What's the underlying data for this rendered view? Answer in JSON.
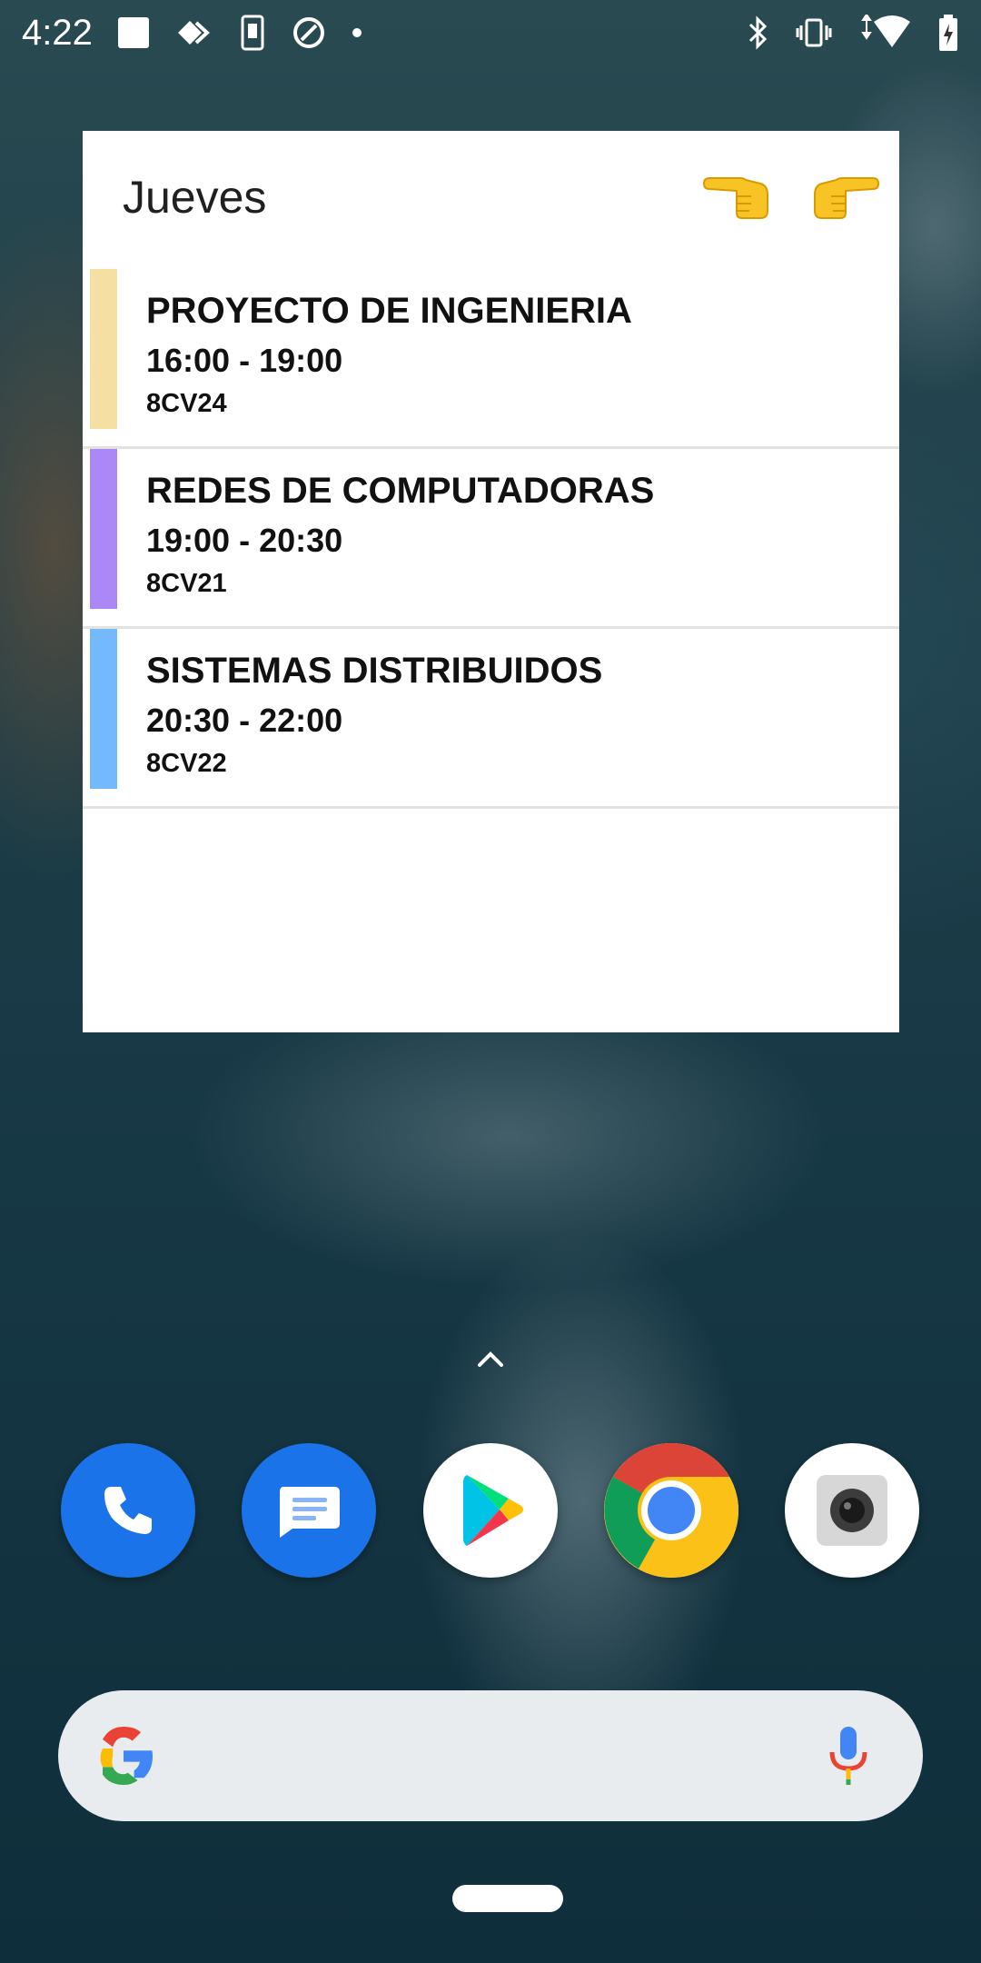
{
  "status_bar": {
    "time": "4:22"
  },
  "widget": {
    "day": "Jueves",
    "nav": {
      "prev_icon": "hand-pointing-left-icon",
      "next_icon": "hand-pointing-right-icon"
    },
    "events": [
      {
        "name": "PROYECTO DE INGENIERIA",
        "time": "16:00 - 19:00",
        "group": "8CV24",
        "color": "#f5dfa3"
      },
      {
        "name": "REDES DE COMPUTADORAS",
        "time": "19:00 - 20:30",
        "group": "8CV21",
        "color": "#ac88f7"
      },
      {
        "name": "SISTEMAS DISTRIBUIDOS",
        "time": "20:30 - 22:00",
        "group": "8CV22",
        "color": "#73b9fb"
      }
    ]
  },
  "dock": {
    "apps": [
      {
        "name": "phone",
        "icon": "phone-icon"
      },
      {
        "name": "messages",
        "icon": "messages-icon"
      },
      {
        "name": "play-store",
        "icon": "play-store-icon"
      },
      {
        "name": "chrome",
        "icon": "chrome-icon"
      },
      {
        "name": "camera",
        "icon": "camera-icon"
      }
    ]
  },
  "search": {
    "query": ""
  }
}
